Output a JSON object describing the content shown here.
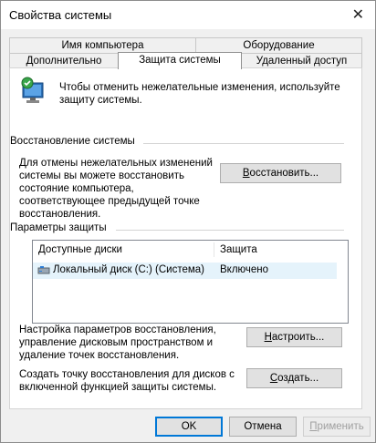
{
  "window": {
    "title": "Свойства системы"
  },
  "tabs": {
    "row1": [
      "Имя компьютера",
      "Оборудование"
    ],
    "row2": [
      "Дополнительно",
      "Защита системы",
      "Удаленный доступ"
    ]
  },
  "intro": {
    "text": "Чтобы отменить нежелательные изменения, используйте защиту системы."
  },
  "restore": {
    "heading": "Восстановление системы",
    "description": "Для отмены нежелательных изменений системы вы можете восстановить состояние компьютера, соответствующее предыдущей точке восстановления.",
    "button_first": "В",
    "button_rest": "осстановить..."
  },
  "protection": {
    "heading": "Параметры защиты",
    "columns": [
      "Доступные диски",
      "Защита"
    ],
    "rows": [
      {
        "drive": "Локальный диск (C:) (Система)",
        "status": "Включено"
      }
    ],
    "configure_text": "Настройка параметров восстановления, управление дисковым пространством и удаление точек восстановления.",
    "configure_first": "Н",
    "configure_rest": "астроить...",
    "create_text": "Создать точку восстановления для дисков с включенной функцией защиты системы.",
    "create_first": "С",
    "create_rest": "оздать..."
  },
  "footer": {
    "ok": "OK",
    "cancel": "Отмена",
    "apply_first": "П",
    "apply_rest": "рименить"
  },
  "colors": {
    "selection": "#e5f3fb",
    "accent": "#0078d7"
  },
  "icons": [
    "close-icon",
    "system-protection-icon",
    "drive-icon"
  ]
}
